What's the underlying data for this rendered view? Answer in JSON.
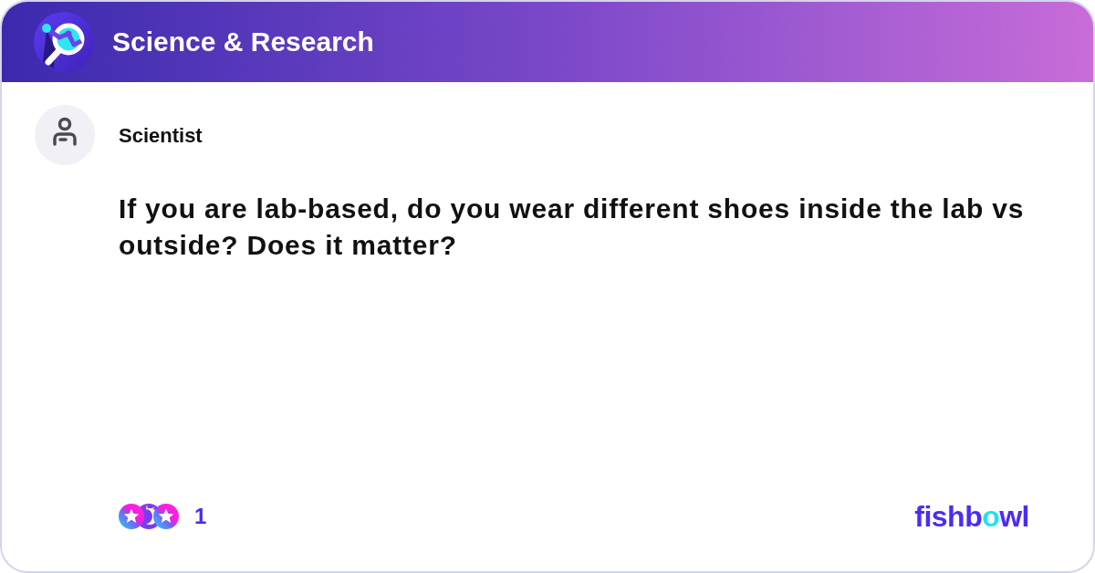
{
  "header": {
    "title": "Science & Research"
  },
  "post": {
    "author": "Scientist",
    "question": "If you are lab-based, do you wear different shoes inside the lab vs outside? Does it matter?"
  },
  "reactions": {
    "count": "1"
  },
  "logo": {
    "segments": [
      {
        "text": "fishb",
        "color": "#4b2cf5"
      },
      {
        "text": "o",
        "color": "#1fe3ee"
      },
      {
        "text": "wl",
        "color": "#4b2cf5"
      }
    ]
  }
}
